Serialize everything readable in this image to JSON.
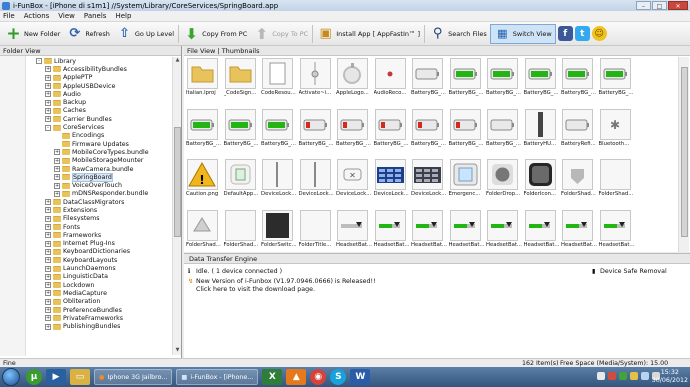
{
  "window": {
    "title": "i-FunBox - [iPhone di s1m1] //System/Library/CoreServices/SpringBoard.app",
    "min": "–",
    "max": "□",
    "close": "✕"
  },
  "menu": [
    "File",
    "Actions",
    "View",
    "Panels",
    "Help"
  ],
  "toolbar": {
    "new_folder": "New Folder",
    "refresh": "Refresh",
    "up_level": "Go Up Level",
    "copy_from_pc": "Copy From PC",
    "copy_to_pc": "Copy To PC",
    "install_app": "Install App [ AppFastIn™ ]",
    "search_files": "Search Files",
    "switch_view": "Switch View"
  },
  "colors": {
    "accent": "#3a78c4",
    "green": "#3aa52e",
    "battery_green": "#22b514",
    "battery_red": "#d12a1f",
    "facebook": "#3b5998",
    "twitter": "#33aaf0",
    "smiley": "#f1c21b"
  },
  "folder_view": {
    "header": "Folder View",
    "items": [
      {
        "label": "Library",
        "depth": 0,
        "expander": "-"
      },
      {
        "label": "AccessibilityBundles",
        "depth": 1,
        "expander": "+"
      },
      {
        "label": "ApplePTP",
        "depth": 1,
        "expander": "+"
      },
      {
        "label": "AppleUSBDevice",
        "depth": 1,
        "expander": "+"
      },
      {
        "label": "Audio",
        "depth": 1,
        "expander": "+"
      },
      {
        "label": "Backup",
        "depth": 1,
        "expander": "+"
      },
      {
        "label": "Caches",
        "depth": 1,
        "expander": "+"
      },
      {
        "label": "Carrier Bundles",
        "depth": 1,
        "expander": "+"
      },
      {
        "label": "CoreServices",
        "depth": 1,
        "expander": "-"
      },
      {
        "label": "Encodings",
        "depth": 2,
        "expander": ""
      },
      {
        "label": "Firmware Updates",
        "depth": 2,
        "expander": ""
      },
      {
        "label": "MobileCoreTypes.bundle",
        "depth": 2,
        "expander": "+"
      },
      {
        "label": "MobileStorageMounter",
        "depth": 2,
        "expander": "+"
      },
      {
        "label": "RawCamera.bundle",
        "depth": 2,
        "expander": "+"
      },
      {
        "label": "SpringBoard",
        "depth": 2,
        "expander": "+"
      },
      {
        "label": "VoiceOverTouch",
        "depth": 2,
        "expander": "+"
      },
      {
        "label": "mDNSResponder.bundle",
        "depth": 2,
        "expander": "+"
      },
      {
        "label": "DataClassMigrators",
        "depth": 1,
        "expander": "+"
      },
      {
        "label": "Extensions",
        "depth": 1,
        "expander": "+"
      },
      {
        "label": "Filesystems",
        "depth": 1,
        "expander": "+"
      },
      {
        "label": "Fonts",
        "depth": 1,
        "expander": "+"
      },
      {
        "label": "Frameworks",
        "depth": 1,
        "expander": "+"
      },
      {
        "label": "Internet Plug-Ins",
        "depth": 1,
        "expander": "+"
      },
      {
        "label": "KeyboardDictionaries",
        "depth": 1,
        "expander": "+"
      },
      {
        "label": "KeyboardLayouts",
        "depth": 1,
        "expander": "+"
      },
      {
        "label": "LaunchDaemons",
        "depth": 1,
        "expander": "+"
      },
      {
        "label": "LinguisticData",
        "depth": 1,
        "expander": "+"
      },
      {
        "label": "Lockdown",
        "depth": 1,
        "expander": "+"
      },
      {
        "label": "MediaCapture",
        "depth": 1,
        "expander": "+"
      },
      {
        "label": "Obliteration",
        "depth": 1,
        "expander": "+"
      },
      {
        "label": "PreferenceBundles",
        "depth": 1,
        "expander": "+"
      },
      {
        "label": "PrivateFrameworks",
        "depth": 1,
        "expander": "+"
      },
      {
        "label": "PublishingBundles",
        "depth": 1,
        "expander": "+"
      }
    ],
    "selected": "SpringBoard"
  },
  "file_view": {
    "tab": "File View | Thumbnails",
    "files": [
      {
        "name": "Italian.lproj",
        "icon": "folder"
      },
      {
        "name": "_CodeSign...",
        "icon": "folder"
      },
      {
        "name": "CodeResou...",
        "icon": "doc"
      },
      {
        "name": "Activate~i...",
        "icon": "activate"
      },
      {
        "name": "AppleLogo...",
        "icon": "apple"
      },
      {
        "name": "AudioReco...",
        "icon": "dot"
      },
      {
        "name": "BatteryBG_...",
        "icon": "battery-gray"
      },
      {
        "name": "BatteryBG_...",
        "icon": "battery-green"
      },
      {
        "name": "BatteryBG_...",
        "icon": "battery-green"
      },
      {
        "name": "BatteryBG_...",
        "icon": "battery-green"
      },
      {
        "name": "BatteryBG_...",
        "icon": "battery-green"
      },
      {
        "name": "BatteryBG_...",
        "icon": "battery-green"
      },
      {
        "name": "BatteryBG_...",
        "icon": "battery-green"
      },
      {
        "name": "BatteryBG_...",
        "icon": "battery-green"
      },
      {
        "name": "BatteryBG_...",
        "icon": "battery-green"
      },
      {
        "name": "BatteryBG_...",
        "icon": "battery-red"
      },
      {
        "name": "BatteryBG_...",
        "icon": "battery-red"
      },
      {
        "name": "BatteryBG_...",
        "icon": "battery-red"
      },
      {
        "name": "BatteryBG_...",
        "icon": "battery-red"
      },
      {
        "name": "BatteryBG_...",
        "icon": "battery-red"
      },
      {
        "name": "BatteryBG_...",
        "icon": "battery-gray"
      },
      {
        "name": "BatteryHU...",
        "icon": "vbar"
      },
      {
        "name": "BatteryRefi...",
        "icon": "battery-gray"
      },
      {
        "name": "Bluetooth...",
        "icon": "bluetooth"
      },
      {
        "name": "Caution.png",
        "icon": "caution"
      },
      {
        "name": "DefaultApp...",
        "icon": "defaultapp"
      },
      {
        "name": "DeviceLock...",
        "icon": "vline"
      },
      {
        "name": "DeviceLock...",
        "icon": "vline"
      },
      {
        "name": "DeviceLock...",
        "icon": "x-key"
      },
      {
        "name": "DeviceLock...",
        "icon": "keypad-blue"
      },
      {
        "name": "DeviceLock...",
        "icon": "keypad-gray"
      },
      {
        "name": "Emergenc...",
        "icon": "emergency"
      },
      {
        "name": "FolderDrop...",
        "icon": "folderdrop"
      },
      {
        "name": "FolderIcon...",
        "icon": "foldericon"
      },
      {
        "name": "FolderShad...",
        "icon": "shield"
      },
      {
        "name": "FolderShad...",
        "icon": "blank"
      },
      {
        "name": "FolderShad...",
        "icon": "arrow"
      },
      {
        "name": "FolderShad...",
        "icon": "blank"
      },
      {
        "name": "FolderSwitc...",
        "icon": "dark"
      },
      {
        "name": "FolderTitle...",
        "icon": "blank"
      },
      {
        "name": "HeadsetBat...",
        "icon": "headset-gray"
      },
      {
        "name": "HeadsetBat...",
        "icon": "headset-green"
      },
      {
        "name": "HeadsetBat...",
        "icon": "headset-green"
      },
      {
        "name": "HeadsetBat...",
        "icon": "headset-green"
      },
      {
        "name": "HeadsetBat...",
        "icon": "headset-green"
      },
      {
        "name": "HeadsetBat...",
        "icon": "headset-green"
      },
      {
        "name": "HeadsetBat...",
        "icon": "headset-green"
      },
      {
        "name": "HeadsetBat...",
        "icon": "headset-green"
      }
    ]
  },
  "transfer": {
    "header": "Data Transfer Engine",
    "idle": "Idle.  ( 1 device connected )",
    "update_notice": "New Version of i-Funbox (V1.97.0946.0666) is Released!!",
    "update_link": "Click here to visit the download page.",
    "safe_remove": "Device Safe Removal"
  },
  "status": {
    "left": "Fine",
    "count": "162 Item(s)",
    "space": "Free Space (Media/System): 15.00 GB/97.97 MB"
  },
  "taskbar": {
    "tasks": [
      "Iphone 3G Jailbro...",
      "i-FunBox - [iPhone..."
    ],
    "time": "15:32",
    "date": "30/06/2012"
  }
}
